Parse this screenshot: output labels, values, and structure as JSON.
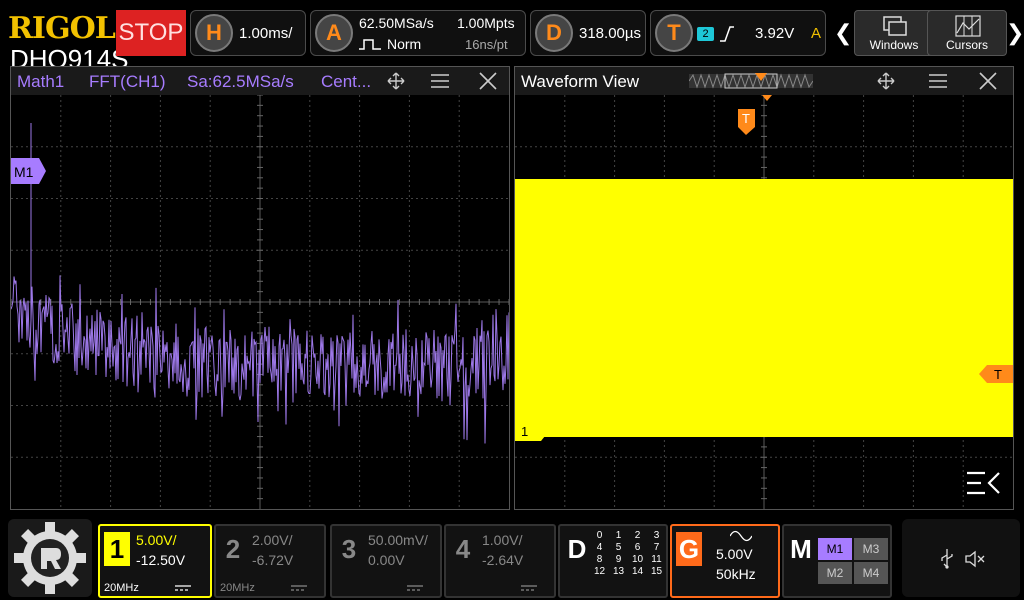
{
  "brand": {
    "name": "RIGOL",
    "model": "DHO914S"
  },
  "run_state": "STOP",
  "horizontal": {
    "key": "H",
    "timebase": "1.00ms/"
  },
  "acquire": {
    "key": "A",
    "sample_rate": "62.50MSa/s",
    "memory_depth": "1.00Mpts",
    "mode": "Norm",
    "sample_interval": "16ns/pt"
  },
  "delay": {
    "key": "D",
    "value": "318.00µs"
  },
  "trigger": {
    "key": "T",
    "source": "2",
    "level": "3.92V",
    "mode": "A"
  },
  "toolbar": {
    "windows_label": "Windows",
    "cursors_label": "Cursors",
    "prev": "❮",
    "next": "❯"
  },
  "math_pane": {
    "title_source": "Math1",
    "title_op": "FFT(CH1)",
    "title_rate": "Sa:62.5MSa/s",
    "title_center": "Cent...",
    "marker": "M1",
    "colors": {
      "trace": "#9d78e8",
      "title": "#a77cff"
    }
  },
  "wave_pane": {
    "title": "Waveform View",
    "trigger_marker": "T",
    "ch1_marker": "1",
    "colors": {
      "trace": "#ffff00"
    }
  },
  "channels": [
    {
      "num": "1",
      "scale": "5.00V/",
      "offset": "-12.50V",
      "bw": "20MHz",
      "active": true,
      "color": "#ffff00"
    },
    {
      "num": "2",
      "scale": "2.00V/",
      "offset": "-6.72V",
      "bw": "20MHz",
      "active": false,
      "color": "#888888"
    },
    {
      "num": "3",
      "scale": "50.00mV/",
      "offset": "0.00V",
      "bw": "",
      "active": false,
      "color": "#888888"
    },
    {
      "num": "4",
      "scale": "1.00V/",
      "offset": "-2.64V",
      "bw": "",
      "active": false,
      "color": "#888888"
    }
  ],
  "digital": {
    "key": "D",
    "bits": [
      "0",
      "1",
      "2",
      "3",
      "4",
      "5",
      "6",
      "7",
      "8",
      "9",
      "10",
      "11",
      "12",
      "13",
      "14",
      "15"
    ]
  },
  "generator": {
    "key": "G",
    "amplitude": "5.00V",
    "frequency": "50kHz"
  },
  "math_menu": {
    "key": "M",
    "items": [
      "M1",
      "M3",
      "M2",
      "M4"
    ]
  },
  "status": {
    "usb_icon": "usb-icon",
    "mute_icon": "speaker-muted-icon"
  }
}
